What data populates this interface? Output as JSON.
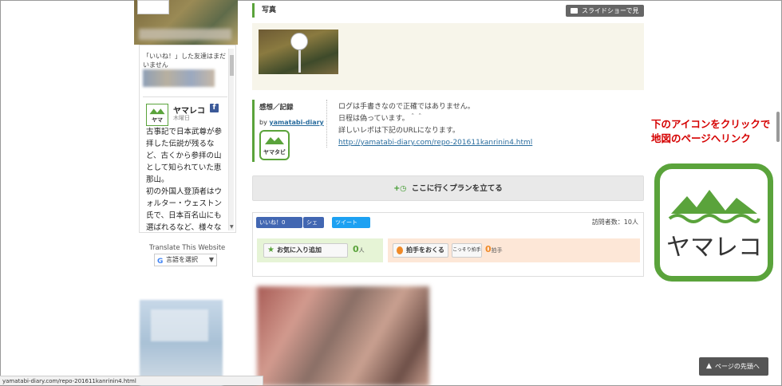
{
  "sidebar": {
    "fb_liked_text": "「いいね！」した友達はまだいません",
    "fb_page_name": "ヤマレコ",
    "fb_day": "木曜日",
    "fb_post_text": "古事記で日本武尊が参拝した伝説が残るなど、古くから参拝の山として知られていた恵那山。\n初の外国人登頂者はウォルター・ウェストン氏で、日本百名山にも選ばれるなど、様々な云われを持っています。",
    "translate_label": "Translate This Website",
    "translate_select": "言語を選択"
  },
  "photo": {
    "title": "写真",
    "slideshow_label": "スライドショーで見る"
  },
  "review": {
    "heading": "感想／記録",
    "by_prefix": "by",
    "author": "yamatabi-diary",
    "logo_label": "ヤマタビ",
    "lines": [
      "ログは手書きなので正確ではありません。",
      "日程は偽っています。＾＾",
      "詳しいレポは下記のURLになります。"
    ],
    "link": "http://yamatabi-diary.com/repo-201611kanrinin4.html"
  },
  "plan_button_label": "ここに行くプランを立てる",
  "social": {
    "like_label": "いいね！0",
    "share_label": "シェア",
    "tweet_label": "ツイート",
    "visits": "訪問者数：10人",
    "fav_label": "お気に入り追加",
    "fav_count": "0",
    "fav_unit": "人",
    "clap_label": "拍手をおくる",
    "secret_label": "こっそり拍手",
    "clap_count": "0",
    "clap_unit": "拍手"
  },
  "annotation": {
    "line1": "下のアイコンをクリックで",
    "line2": "地図のページへリンク",
    "logo_text": "ヤマレコ"
  },
  "back_to_top": "ページの先頭へ",
  "status_url": "yamatabi-diary.com/repo-201611kanrinin4.html",
  "colors": {
    "accent_green": "#5aa33b",
    "annotation_red": "#d50000",
    "facebook_blue": "#4267b2",
    "twitter_blue": "#1da1f2",
    "clap_orange": "#f08a28"
  }
}
